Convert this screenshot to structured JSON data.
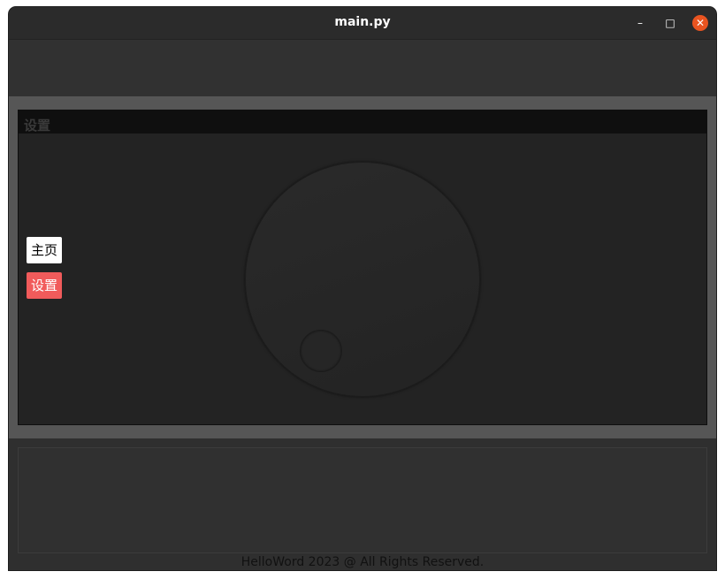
{
  "window": {
    "title": "main.py",
    "minimize_symbol": "–",
    "maximize_symbol": "□",
    "close_symbol": "✕"
  },
  "panel": {
    "title": "设置"
  },
  "nav": {
    "home_label": "主页",
    "settings_label": "设置"
  },
  "footer": {
    "text": "HelloWord 2023 @ All Rights Reserved."
  },
  "colors": {
    "close_button": "#e95420",
    "active_nav": "#f15b5b",
    "inactive_nav": "#ffffff"
  }
}
